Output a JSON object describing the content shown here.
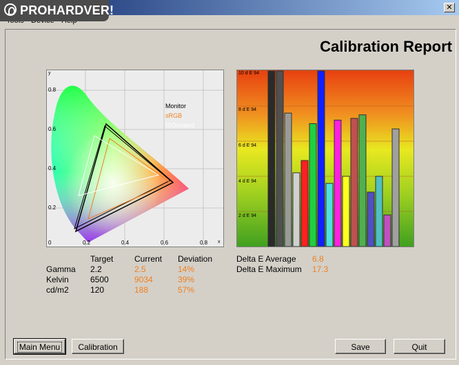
{
  "window": {
    "close_glyph": "✕"
  },
  "logo": {
    "text": "PROHARDVER!"
  },
  "menu": [
    "Tools",
    "Device",
    "Help"
  ],
  "report_title": "Calibration Report",
  "cie": {
    "axis_y_label": "y",
    "axis_x_label": "x",
    "y_ticks": [
      "0.8",
      "0.6",
      "0.4",
      "0.2",
      "0"
    ],
    "x_ticks": [
      "0.2",
      "0.4",
      "0.6",
      "0.8"
    ],
    "legend": [
      {
        "label": "Monitor",
        "color": "#000000"
      },
      {
        "label": "sRGB",
        "color": "#f08020"
      },
      {
        "label": "ISOcoated",
        "color": "#ffffff"
      }
    ]
  },
  "chart_data": {
    "type": "bar",
    "ylim": [
      0,
      10
    ],
    "tick_labels": [
      "10 d E 94",
      "8 d E 94",
      "6 d E 94",
      "4 d E 94",
      "2 d E 94"
    ],
    "values": [
      10,
      10,
      7.6,
      4.2,
      4.9,
      7.0,
      10,
      3.6,
      7.2,
      4.0,
      7.3,
      7.5,
      3.1,
      4.0,
      1.8,
      6.7
    ],
    "colors": [
      "#2a2a2a",
      "#505050",
      "#9a9a9a",
      "#d0d0d0",
      "#ff2020",
      "#20d040",
      "#1020ff",
      "#50e0e0",
      "#ff20e0",
      "#ffff20",
      "#c05050",
      "#50b050",
      "#5050c0",
      "#50c0c0",
      "#c050c0",
      "#a0a0a0"
    ]
  },
  "measurements": {
    "headers": [
      "Target",
      "Current",
      "Deviation"
    ],
    "rows": [
      {
        "label": "Gamma",
        "target": "2.2",
        "current": "2.5",
        "deviation": "14%"
      },
      {
        "label": "Kelvin",
        "target": "6500",
        "current": "9034",
        "deviation": "39%"
      },
      {
        "label": "cd/m2",
        "target": "120",
        "current": "188",
        "deviation": "57%"
      }
    ]
  },
  "delta_e": {
    "average_label": "Delta E Average",
    "average": "6.8",
    "maximum_label": "Delta E Maximum",
    "maximum": "17.3"
  },
  "buttons": {
    "main_menu": "Main Menu",
    "calibration": "Calibration",
    "save": "Save",
    "quit": "Quit"
  }
}
